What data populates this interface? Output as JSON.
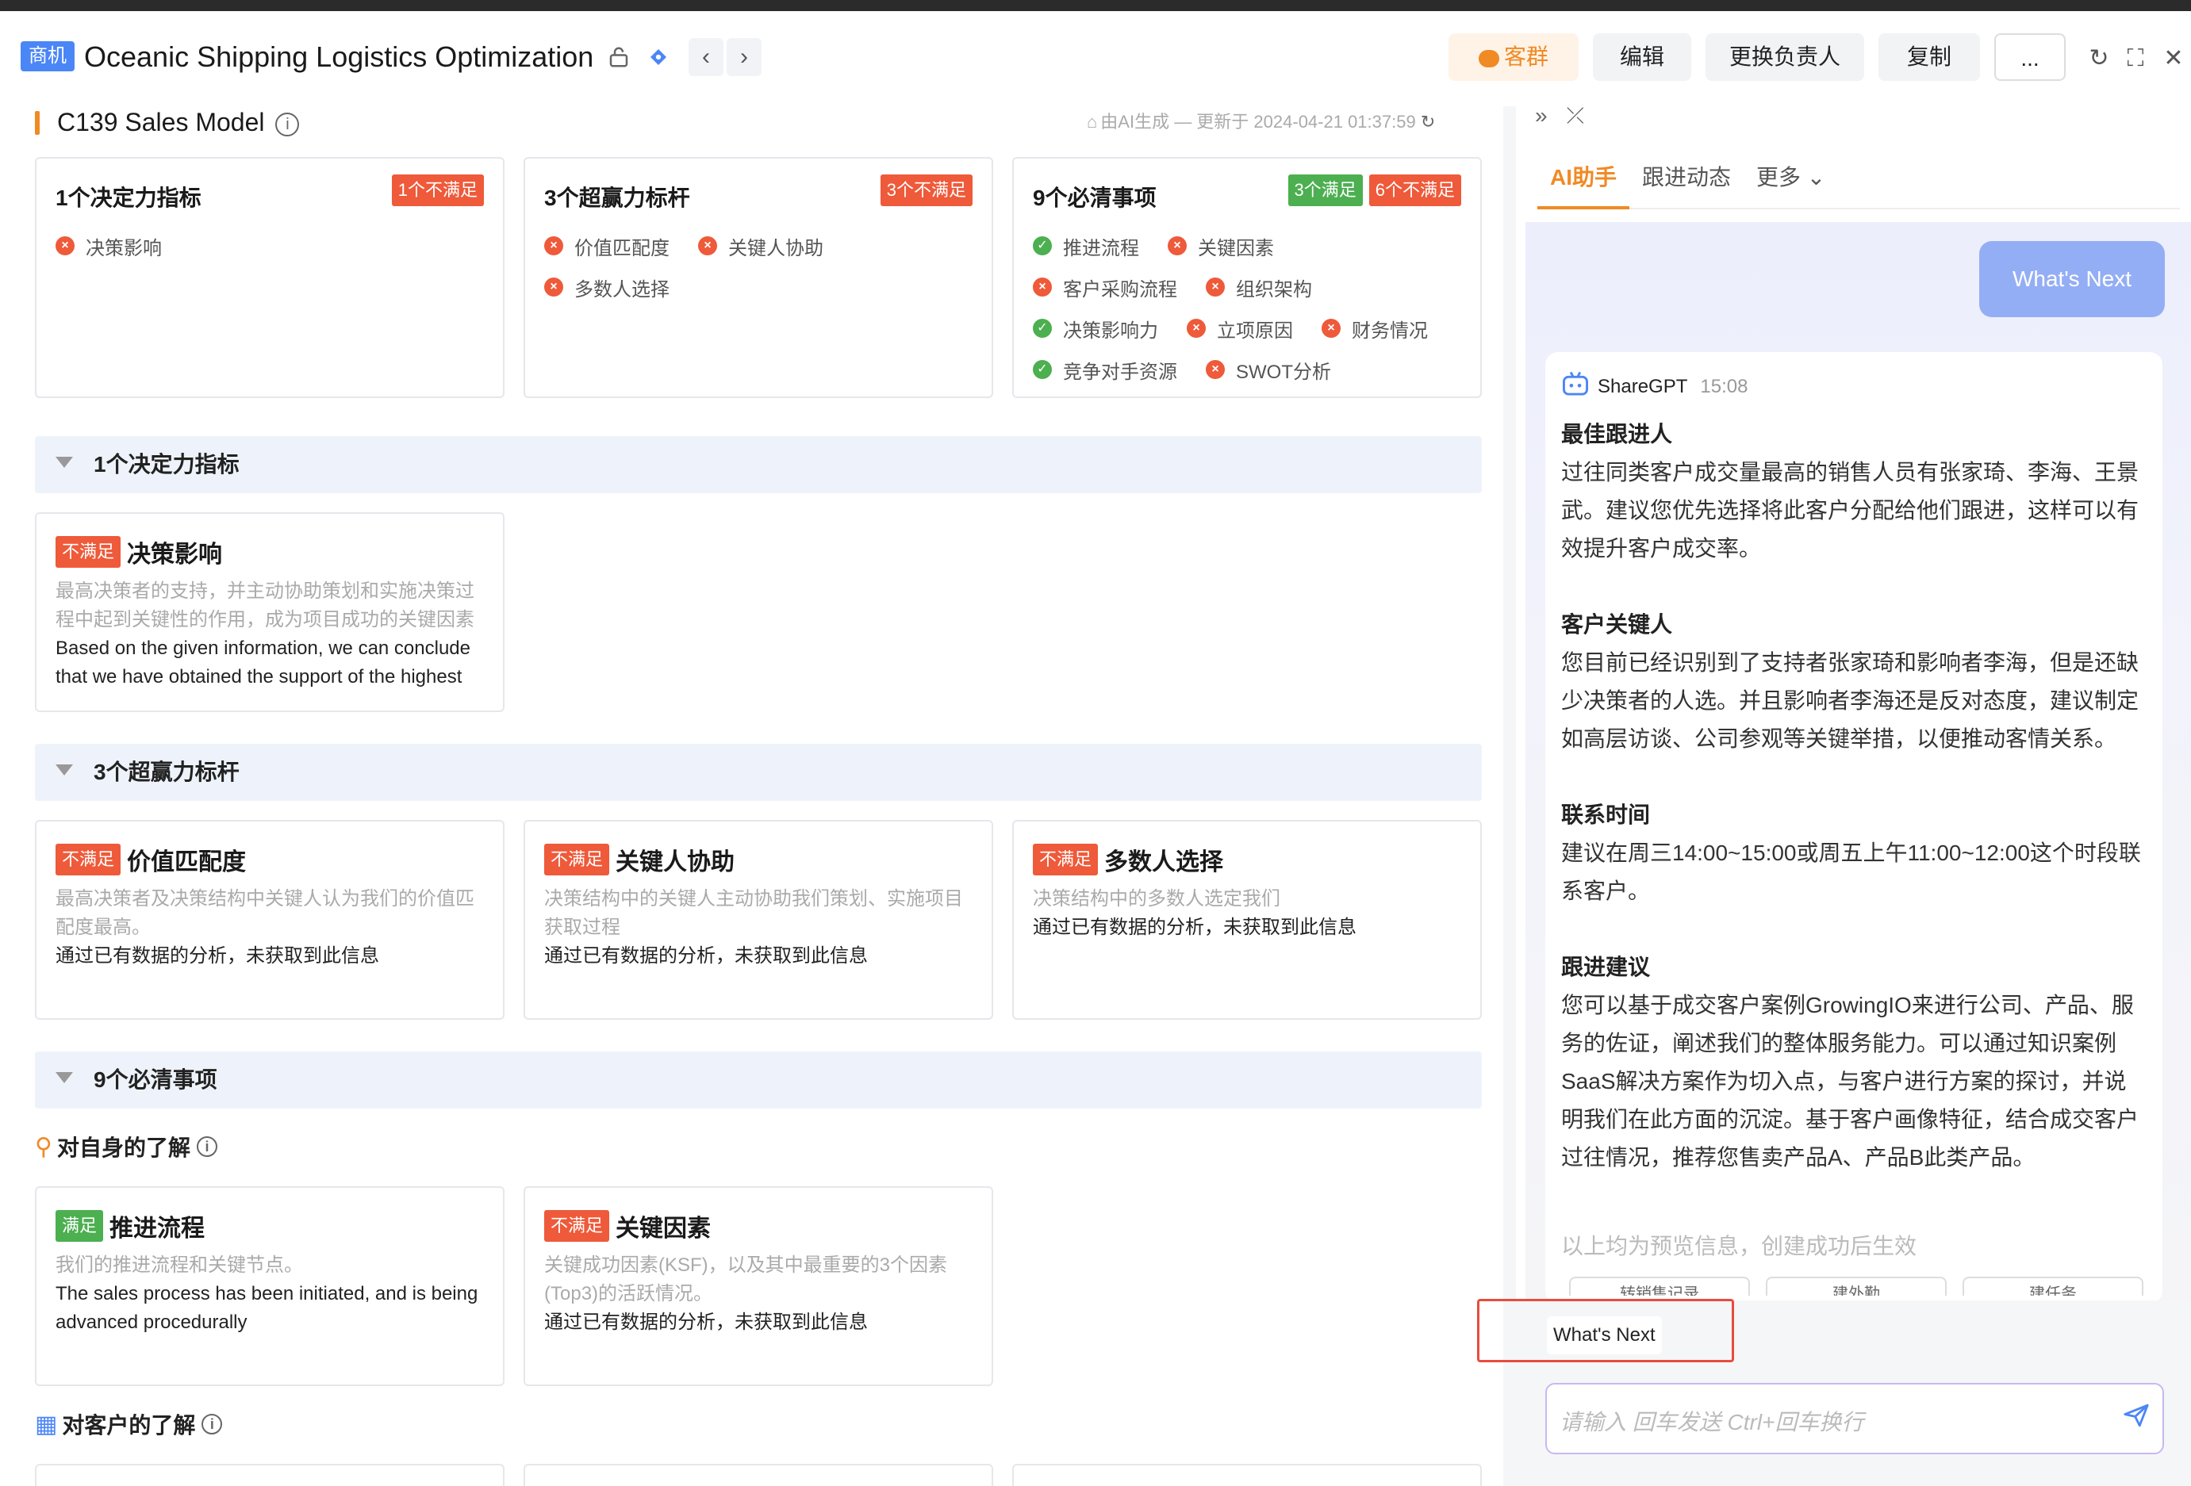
{
  "header": {
    "tag": "商机",
    "title": "Oceanic Shipping Logistics Optimization",
    "buttons": {
      "group": "客群",
      "edit": "编辑",
      "change_owner": "更换负责人",
      "copy": "复制",
      "more": "..."
    },
    "icons": [
      "lock-icon",
      "bookmark-icon",
      "chevron-left-icon",
      "chevron-right-icon",
      "refresh-icon",
      "fullscreen-icon",
      "close-icon"
    ]
  },
  "model": {
    "title": "C139 Sales Model",
    "generated_note": "由AI生成 — 更新于 2024-04-21 01:37:59"
  },
  "summary_cards": [
    {
      "title": "1个决定力指标",
      "badges": [
        {
          "text": "1个不满足",
          "type": "red"
        }
      ],
      "rows": [
        [
          {
            "text": "决策影响",
            "ok": false
          }
        ]
      ]
    },
    {
      "title": "3个超赢力标杆",
      "badges": [
        {
          "text": "3个不满足",
          "type": "red"
        }
      ],
      "rows": [
        [
          {
            "text": "价值匹配度",
            "ok": false
          },
          {
            "text": "关键人协助",
            "ok": false
          }
        ],
        [
          {
            "text": "多数人选择",
            "ok": false
          }
        ]
      ]
    },
    {
      "title": "9个必清事项",
      "badges": [
        {
          "text": "3个满足",
          "type": "green"
        },
        {
          "text": "6个不满足",
          "type": "red"
        }
      ],
      "rows": [
        [
          {
            "text": "推进流程",
            "ok": true
          },
          {
            "text": "关键因素",
            "ok": false
          }
        ],
        [
          {
            "text": "客户采购流程",
            "ok": false
          },
          {
            "text": "组织架构",
            "ok": false
          }
        ],
        [
          {
            "text": "决策影响力",
            "ok": true
          },
          {
            "text": "立项原因",
            "ok": false
          },
          {
            "text": "财务情况",
            "ok": false
          }
        ],
        [
          {
            "text": "竞争对手资源",
            "ok": true
          },
          {
            "text": "SWOT分析",
            "ok": false
          }
        ]
      ]
    }
  ],
  "sections": {
    "s1": "1个决定力指标",
    "s2": "3个超赢力标杆",
    "s3": "9个必清事项",
    "sub1": "对自身的了解",
    "sub2": "对客户的了解"
  },
  "detail_cards": {
    "decision": {
      "badge": "不满足",
      "name": "决策影响",
      "desc": "最高决策者的支持，并主动协助策划和实施决策过程中起到关键性的作用，成为项目成功的关键因素",
      "result": "Based on the given information, we can conclude that we have obtained the support of the highest decision maker"
    },
    "value": {
      "badge": "不满足",
      "name": "价值匹配度",
      "desc": "最高决策者及决策结构中关键人认为我们的价值匹配度最高。",
      "result": "通过已有数据的分析，未获取到此信息"
    },
    "keyhelp": {
      "badge": "不满足",
      "name": "关键人协助",
      "desc": "决策结构中的关键人主动协助我们策划、实施项目获取过程",
      "result": "通过已有数据的分析，未获取到此信息"
    },
    "majority": {
      "badge": "不满足",
      "name": "多数人选择",
      "desc": "决策结构中的多数人选定我们",
      "result": "通过已有数据的分析，未获取到此信息"
    },
    "process": {
      "badge": "满足",
      "name": "推进流程",
      "desc": "我们的推进流程和关键节点。",
      "result": "The sales process has been initiated, and is being advanced procedurally"
    },
    "factor": {
      "badge": "不满足",
      "name": "关键因素",
      "desc": "关键成功因素(KSF)，以及其中最重要的3个因素(Top3)的活跃情况。",
      "result": "通过已有数据的分析，未获取到此信息"
    }
  },
  "panel": {
    "tabs": [
      "AI助手",
      "跟进动态",
      "更多"
    ],
    "question": "What's Next",
    "bot_name": "ShareGPT",
    "bot_time": "15:08",
    "blocks": [
      {
        "h": "最佳跟进人",
        "p": "过往同类客户成交量最高的销售人员有张家琦、李海、王景武。建议您优先选择将此客户分配给他们跟进，这样可以有效提升客户成交率。"
      },
      {
        "h": "客户关键人",
        "p": "您目前已经识别到了支持者张家琦和影响者李海，但是还缺少决策者的人选。并且影响者李海还是反对态度，建议制定如高层访谈、公司参观等关键举措，以便推动客情关系。"
      },
      {
        "h": "联系时间",
        "p": "建议在周三14:00~15:00或周五上午11:00~12:00这个时段联系客户。"
      },
      {
        "h": "跟进建议",
        "p": "您可以基于成交客户案例GrowingIO来进行公司、产品、服务的佐证，阐述我们的整体服务能力。可以通过知识案例SaaS解决方案作为切入点，与客户进行方案的探讨，并说明我们在此方面的沉淀。基于客户画像特征，结合成交客户过往情况，推荐您售卖产品A、产品B此类产品。"
      }
    ],
    "preview_note": "以上均为预览信息，创建成功后生效",
    "chips": [
      "转销售记录",
      "建外勤",
      "建任务"
    ],
    "suggestion": "What's Next",
    "input_placeholder": "请输入 回车发送 Ctrl+回车换行"
  },
  "colors": {
    "accent": "#f08a24",
    "red": "#ee5a3a",
    "green": "#4caf50",
    "blue": "#4b86f7"
  }
}
